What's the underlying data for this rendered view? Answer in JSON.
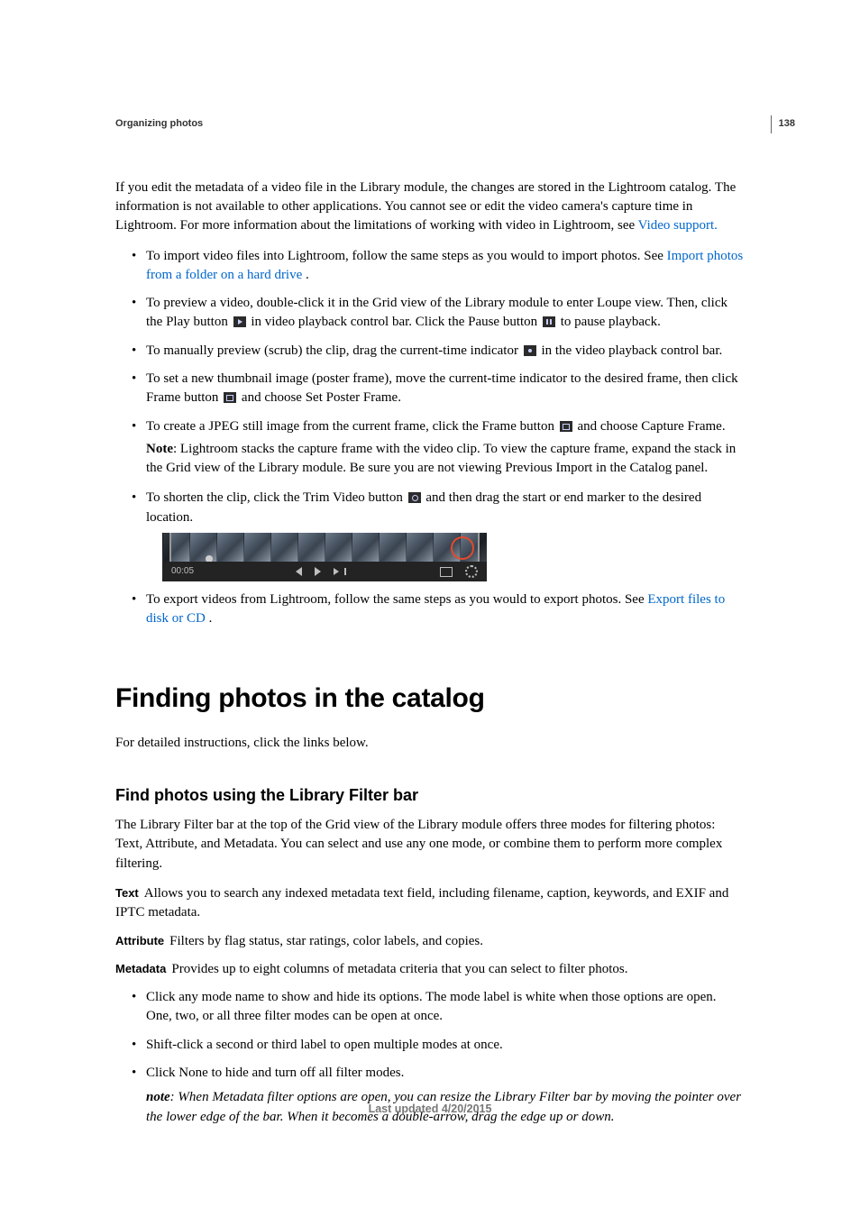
{
  "page_number": "138",
  "running_head": "Organizing photos",
  "intro_paragraph_a": "If you edit the metadata of a video file in the Library module, the changes are stored in the Lightroom catalog. The information is not available to other applications. You cannot see or edit the video camera's capture time in Lightroom. For more information about the limitations of working with video in Lightroom, see ",
  "intro_link": "Video support.",
  "bullets_top": {
    "b1a": "To import video files into Lightroom, follow the same steps as you would to import photos. See ",
    "b1link": "Import photos from a folder on a hard drive",
    "b1b": " .",
    "b2a": "To preview a video, double-click it in the Grid view of the Library module to enter Loupe view. Then, click the Play button ",
    "b2b": "in video playback control bar. Click the Pause button ",
    "b2c": "to pause playback.",
    "b3a": "To manually preview (scrub) the clip, drag the current-time indicator ",
    "b3b": "in the video playback control bar.",
    "b4a": "To set a new thumbnail image (poster frame), move the current-time indicator to the desired frame, then click Frame button ",
    "b4b": "and choose Set Poster Frame.",
    "b5a": "To create a JPEG still image from the current frame, click the Frame button ",
    "b5b": "and choose Capture Frame.",
    "note_label": "Note",
    "note_text": ": Lightroom stacks the capture frame with the video clip. To view the capture frame, expand the stack in the Grid view of the Library module. Be sure you are not viewing Previous Import in the Catalog panel.",
    "b6a": "To shorten the clip, click the Trim Video button ",
    "b6b": "and then drag the start or end marker to the desired location."
  },
  "video_controls_time": "00:05",
  "export_bullet_a": "To export videos from Lightroom, follow the same steps as you would to export photos. See ",
  "export_link": "Export files to disk or CD",
  "export_bullet_b": " .",
  "h1": "Finding photos in the catalog",
  "h1_sub": "For detailed instructions, click the links below.",
  "h2": "Find photos using the Library Filter bar",
  "filter_intro": "The Library Filter bar at the top of the Grid view of the Library module offers three modes for filtering photos: Text, Attribute, and Metadata. You can select and use any one mode, or combine them to perform more complex filtering.",
  "defs": {
    "text_label": "Text",
    "text_body": "Allows you to search any indexed metadata text field, including filename, caption, keywords, and EXIF and IPTC metadata.",
    "attr_label": "Attribute",
    "attr_body": "Filters by flag status, star ratings, color labels, and copies.",
    "meta_label": "Metadata",
    "meta_body": "Provides up to eight columns of metadata criteria that you can select to filter photos."
  },
  "bullets_bottom": {
    "b1": "Click any mode name to show and hide its options. The mode label is white when those options are open. One, two, or all three filter modes can be open at once.",
    "b2": "Shift-click a second or third label to open multiple modes at once.",
    "b3": "Click None to hide and turn off all filter modes.",
    "note_word": "note",
    "note_body": ": When Metadata filter options are open, you can resize the Library Filter bar by moving the pointer over the lower edge of the bar. When it becomes a double-arrow, drag the edge up or down."
  },
  "footer": "Last updated 4/20/2015"
}
